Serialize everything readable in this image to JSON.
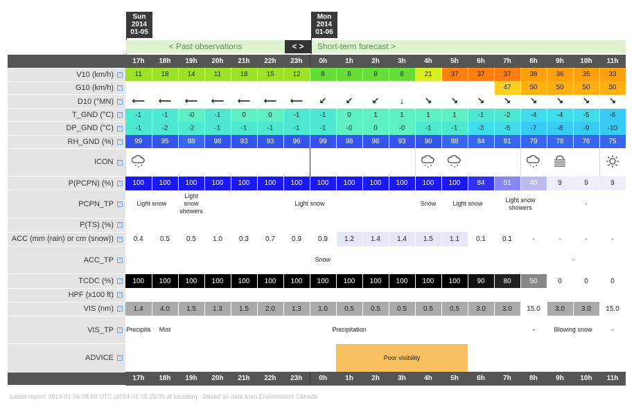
{
  "days": [
    {
      "name": "Sun",
      "year": "2014",
      "date": "01-05"
    },
    {
      "name": "Mon",
      "year": "2014",
      "date": "01-06"
    }
  ],
  "nav": {
    "past": "<  Past observations  ",
    "toggle": "< >",
    "future": "Short-term forecast  >"
  },
  "hours": [
    "17h",
    "18h",
    "19h",
    "20h",
    "21h",
    "22h",
    "23h",
    "0h",
    "1h",
    "2h",
    "3h",
    "4h",
    "5h",
    "6h",
    "7h",
    "8h",
    "9h",
    "10h",
    "11h"
  ],
  "labels": {
    "v10": "V10 (km/h)",
    "g10": "G10 (km/h)",
    "d10": "D10 (°MN)",
    "tgnd": "T_GND (°C)",
    "dpgnd": "DP_GND (°C)",
    "rhgnd": "RH_GND (%)",
    "icon": "ICON",
    "ppcpn": "P(PCPN) (%)",
    "pcpntp": "PCPN_TP",
    "pts": "P(TS) (%)",
    "acc": "ACC (mm (rain) or cm (snow))",
    "acctp": "ACC_TP",
    "tcdc": "TCDC (%)",
    "hpf": "HPF (x100 ft)",
    "vis": "VIS (nm)",
    "vistp": "VIS_TP",
    "advice": "ADVICE"
  },
  "v10": [
    "11",
    "18",
    "14",
    "11",
    "18",
    "15",
    "12",
    "8",
    "8",
    "8",
    "8",
    "21",
    "37",
    "37",
    "37",
    "38",
    "36",
    "35",
    "33"
  ],
  "v10_colors": [
    "#9ee02a",
    "#9ee02a",
    "#9ee02a",
    "#9ee02a",
    "#9ee02a",
    "#9ee02a",
    "#9ee02a",
    "#66dd3a",
    "#66dd3a",
    "#66dd3a",
    "#66dd3a",
    "#d8ee20",
    "#ff7f10",
    "#ff7f10",
    "#ff7f10",
    "#ffa010",
    "#ffa010",
    "#ffa010",
    "#ffa010"
  ],
  "g10": [
    "",
    "",
    "",
    "",
    "",
    "",
    "",
    "",
    "",
    "",
    "",
    "",
    "",
    "",
    "47",
    "50",
    "50",
    "50",
    "50"
  ],
  "d10": [
    "⟵",
    "⟵",
    "⟵",
    "⟵",
    "⟵",
    "⟵",
    "⟵",
    "↙",
    "↙",
    "↙",
    "↓",
    "↘",
    "↘",
    "↘",
    "↘",
    "↘",
    "↘",
    "↘",
    "↘"
  ],
  "tgnd": [
    "-1",
    "-1",
    "-0",
    "-1",
    "0",
    "0",
    "-1",
    "-1",
    "0",
    "1",
    "1",
    "1",
    "1",
    "-1",
    "-2",
    "-4",
    "-4",
    "-5",
    "-6"
  ],
  "dpgnd": [
    "-1",
    "-2",
    "-2",
    "-1",
    "-1",
    "-1",
    "-1",
    "-1",
    "-0",
    "0",
    "-0",
    "-1",
    "-1",
    "-3",
    "-5",
    "-7",
    "-8",
    "-9",
    "-10"
  ],
  "rhgnd": [
    "99",
    "95",
    "88",
    "98",
    "93",
    "93",
    "96",
    "99",
    "98",
    "96",
    "93",
    "90",
    "88",
    "84",
    "81",
    "79",
    "78",
    "76",
    "75"
  ],
  "ppcpn": [
    "100",
    "100",
    "100",
    "100",
    "100",
    "100",
    "100",
    "100",
    "100",
    "100",
    "100",
    "100",
    "100",
    "84",
    "51",
    "40",
    "9",
    "9",
    "9"
  ],
  "pcpntp": {
    "a": "Light snow",
    "b": "Light snow showers",
    "c": "Light snow",
    "d": "Snow",
    "e": "Light snow",
    "f": "Light snow showers",
    "g": "-"
  },
  "acc": [
    "0.4",
    "0.5",
    "0.5",
    "1.0",
    "0.3",
    "0.7",
    "0.9",
    "0.9",
    "1.2",
    "1.4",
    "1.4",
    "1.5",
    "1.1",
    "0.1",
    "0.1",
    "-",
    "-",
    "-",
    "-"
  ],
  "acctp": {
    "a": "Snow",
    "b": "-"
  },
  "tcdc": [
    "100",
    "100",
    "100",
    "100",
    "100",
    "100",
    "100",
    "100",
    "100",
    "100",
    "100",
    "100",
    "100",
    "90",
    "80",
    "50",
    "0",
    "0",
    "0"
  ],
  "vis": [
    "1.4",
    "4.0",
    "1.5",
    "1.3",
    "1.5",
    "2.0",
    "1.3",
    "1.0",
    "0.5",
    "0.5",
    "0.5",
    "0.5",
    "0.5",
    "3.0",
    "3.0",
    "15.0",
    "3.0",
    "3.0",
    "15.0"
  ],
  "vistp": {
    "a": "Precipita",
    "b": "Mist",
    "c": "Precipitation",
    "d": "-",
    "e": "Blowing snow",
    "f": "-"
  },
  "advice": "Poor visibility",
  "footer": "Latest report: 2014-01-06 03:00 UTC (2014-01-05 23:00 at location) - Based on data from Environment Canada",
  "qmark": "?"
}
